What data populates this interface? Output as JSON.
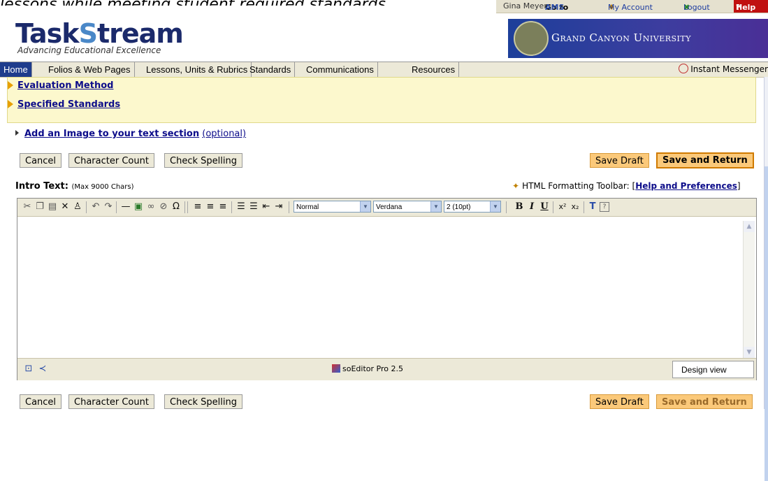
{
  "caption": "lessons while meeting student required standards.",
  "topbar": {
    "user": "Gina Meyer",
    "goto_prefix": "Go to ",
    "goto_target": "AMS",
    "my_account": "My Account",
    "logout": "Logout",
    "help": "Help"
  },
  "brand": {
    "logo_part1": "Task",
    "logo_s": "S",
    "logo_part2": "tream",
    "tagline": "Advancing Educational Excellence",
    "university": "Grand Canyon University"
  },
  "nav": {
    "tabs": [
      "Home",
      "Folios & Web Pages",
      "Lessons, Units & Rubrics",
      "Standards",
      "Communications",
      "Resources"
    ],
    "active": "Home",
    "instant_messenger": "Instant Messenger"
  },
  "sections": {
    "evaluation_method": "Evaluation Method",
    "specified_standards": "Specified Standards"
  },
  "add_image": {
    "label": "Add an Image to your text section",
    "optional": "(optional)"
  },
  "buttons": {
    "cancel": "Cancel",
    "character_count": "Character Count",
    "check_spelling": "Check Spelling",
    "save_draft": "Save Draft",
    "save_and_return": "Save and Return"
  },
  "intro": {
    "label": "Intro Text:",
    "limit": "(Max 9000 Chars)"
  },
  "formatting": {
    "label": "HTML Formatting Toolbar:",
    "link": "Help and Preferences"
  },
  "editor": {
    "style": "Normal",
    "font": "Verdana",
    "size": "2 (10pt)",
    "brand": "soEditor Pro 2.5",
    "view_mode": "Design view"
  }
}
